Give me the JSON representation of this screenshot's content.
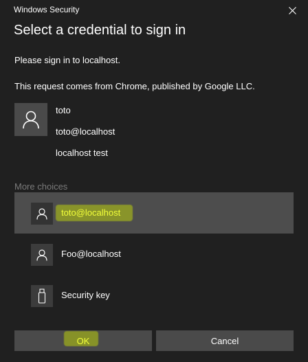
{
  "window": {
    "app_title": "Windows Security",
    "close_icon": "close-icon"
  },
  "dialog": {
    "heading": "Select a credential to sign in",
    "message_1": "Please sign in to localhost.",
    "message_2": "This request comes from Chrome, published by Google LLC."
  },
  "primary_credential": {
    "icon": "user-icon",
    "name": "toto",
    "email": "toto@localhost",
    "description": "localhost test"
  },
  "more_choices": {
    "label": "More choices",
    "items": [
      {
        "label": "toto@localhost",
        "icon": "user-icon",
        "selected": true
      },
      {
        "label": "Foo@localhost",
        "icon": "user-icon",
        "selected": false
      },
      {
        "label": "Security key",
        "icon": "usb-key-icon",
        "selected": false
      }
    ]
  },
  "buttons": {
    "ok": "OK",
    "cancel": "Cancel"
  },
  "colors": {
    "background": "#202020",
    "selected_row": "#4d4d4d",
    "button": "#4a4a4a",
    "muted_text": "#7a7a7a",
    "highlight": "#d2eb00"
  }
}
